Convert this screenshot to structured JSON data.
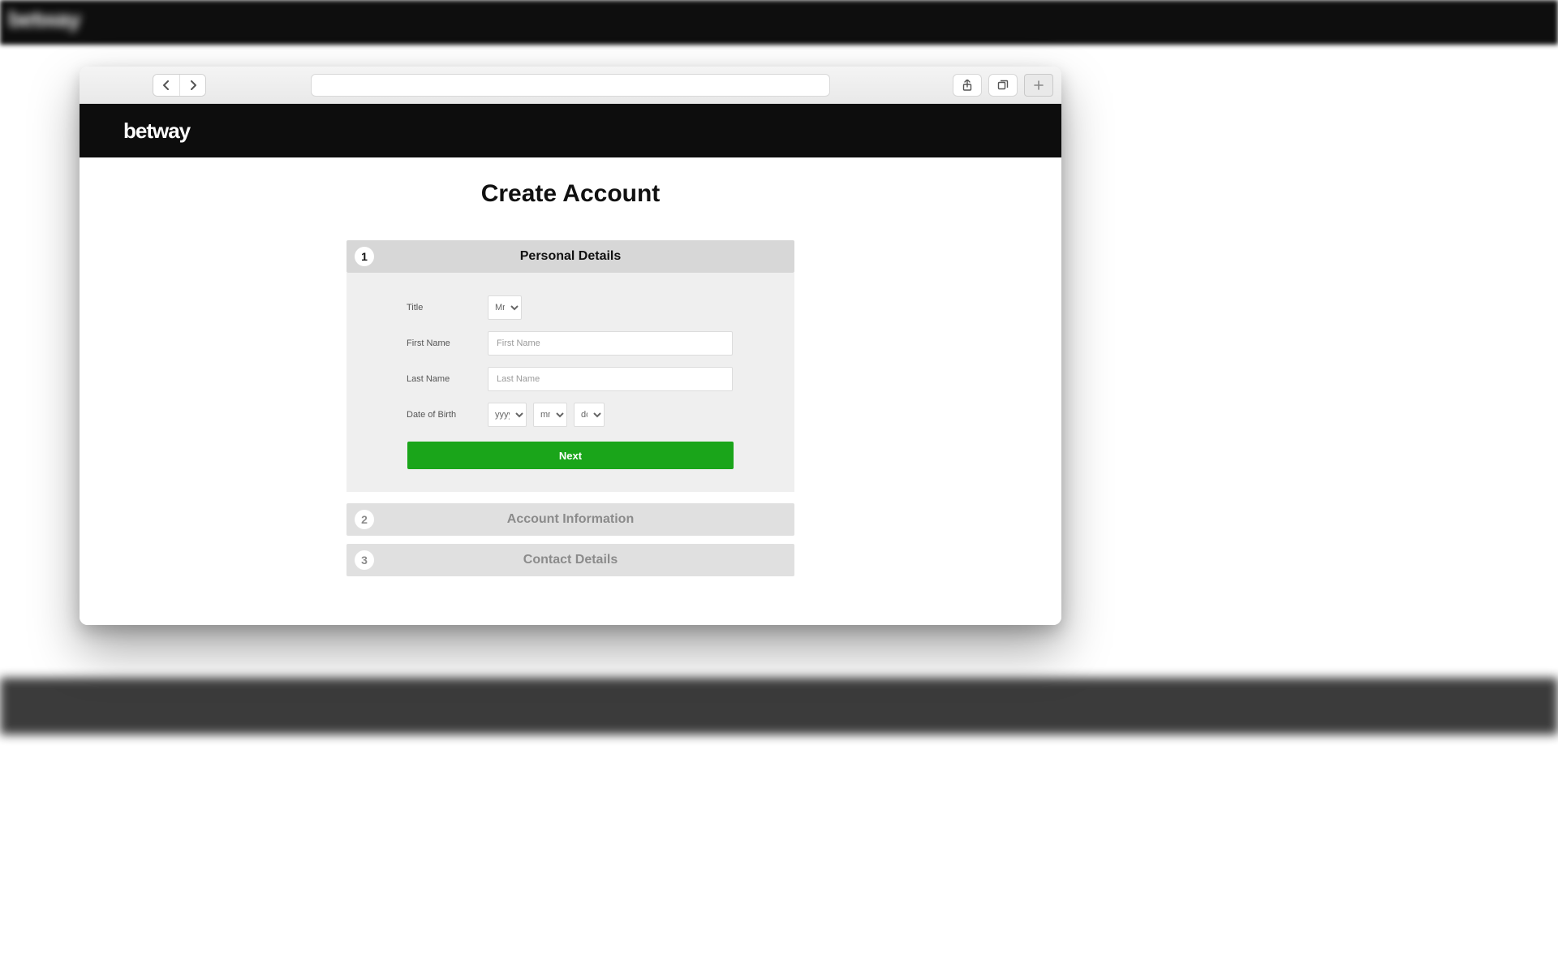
{
  "backdrop": {
    "brand": "betway"
  },
  "site": {
    "brand": "betway"
  },
  "page": {
    "title": "Create Account"
  },
  "steps": {
    "s1": {
      "num": "1",
      "title": "Personal Details"
    },
    "s2": {
      "num": "2",
      "title": "Account Information"
    },
    "s3": {
      "num": "3",
      "title": "Contact Details"
    }
  },
  "form": {
    "title_label": "Title",
    "title_value": "Mr",
    "first_name_label": "First Name",
    "first_name_placeholder": "First Name",
    "last_name_label": "Last Name",
    "last_name_placeholder": "Last Name",
    "dob_label": "Date of Birth",
    "dob_year": "yyyy",
    "dob_month": "mm",
    "dob_day": "dd",
    "next_button": "Next"
  }
}
